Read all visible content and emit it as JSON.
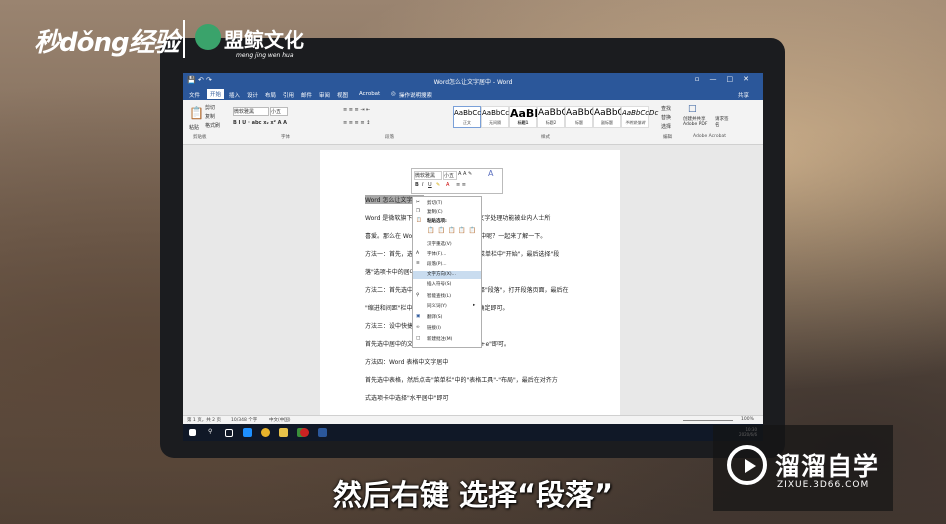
{
  "overlay": {
    "logo_left": "秒dǒng经验",
    "logo_right": "盟鲸文化",
    "logo_right_sub": "meng jing wen hua",
    "subtitle": "然后右键 选择“段落”",
    "watermark_title": "溜溜自学",
    "watermark_url": "ZIXUE.3D66.COM"
  },
  "word": {
    "window_title": "Word怎么让文字居中 - Word",
    "share": "共享",
    "tabs": [
      "文件",
      "开始",
      "插入",
      "设计",
      "布局",
      "引用",
      "邮件",
      "审阅",
      "视图",
      "Acrobat"
    ],
    "tell_me": "操作说明搜索",
    "ribbon": {
      "clipboard": "剪贴板",
      "paste": "粘贴",
      "cut": "剪切",
      "copy": "复制",
      "format_painter": "格式刷",
      "font": "字体",
      "font_name": "微软雅黑",
      "font_size": "小五",
      "paragraph": "段落",
      "styles": "样式",
      "editing": "编辑",
      "find": "查找",
      "replace": "替换",
      "select": "选择",
      "acrobat_group": "Adobe Acrobat",
      "create_pdf": "创建并共享Adobe PDF",
      "request_sign": "请求签名",
      "style_items": [
        {
          "preview": "AaBbCcDc",
          "name": "正文"
        },
        {
          "preview": "AaBbCcDc",
          "name": "无间隔"
        },
        {
          "preview": "AaBl",
          "name": "标题1"
        },
        {
          "preview": "AaBbC",
          "name": "标题2"
        },
        {
          "preview": "AaBbC",
          "name": "标题"
        },
        {
          "preview": "AaBbC",
          "name": "副标题"
        },
        {
          "preview": "AaBbCcDc",
          "name": "不明显强调"
        }
      ]
    },
    "doc_lines": [
      "Word 怎么让文字居中",
      "Word 是微软旗下的一款办公软件，强大的文字处理功能被业内人士所",
      "喜爱。那么在 Word 文档中怎样设置文字居中呢？一起来了解一下。",
      "方法一：首先，选中需要居中的文字，点击菜单栏中\"开始\"，最后选择\"段",
      "落\"选项卡中的居中即可。",
      "方法二：首先选中需要居中的文字，右键选择\"段落\"，打开段落页面，最后在",
      "\"缩进和间距\"栏中的对齐方式中选择居中，确定即可。",
      "方法三：设中快捷键",
      "首先选中居中的文字，然后在键盘上按\"Ctrl+e\"即可。",
      "方法四：Word 表格中文字居中",
      "首先选中表格，然后点击\"菜单栏\"中的\"表格工具\"-\"布局\"，最后在对齐方",
      "式选项卡中选择\"水平居中\"即可"
    ],
    "mini_toolbar": {
      "font": "微软雅黑",
      "size": "小五",
      "bold": "B",
      "italic": "I",
      "underline": "U"
    },
    "context_menu": [
      "剪切(T)",
      "复制(C)",
      "粘贴选项:",
      "汉字重选(V)",
      "字体(F)...",
      "段落(P)...",
      "文字方向(X)...",
      "插入符号(S)",
      "智能查找(L)",
      "同义词(Y)",
      "翻译(S)",
      "链接(I)",
      "新建批注(M)"
    ],
    "status": {
      "page": "第 1 页，共 2 页",
      "words": "10/348 个字",
      "lang": "中文(中国)",
      "zoom": "100%"
    },
    "taskbar_time": "10:30",
    "taskbar_date": "2020/6/6"
  }
}
